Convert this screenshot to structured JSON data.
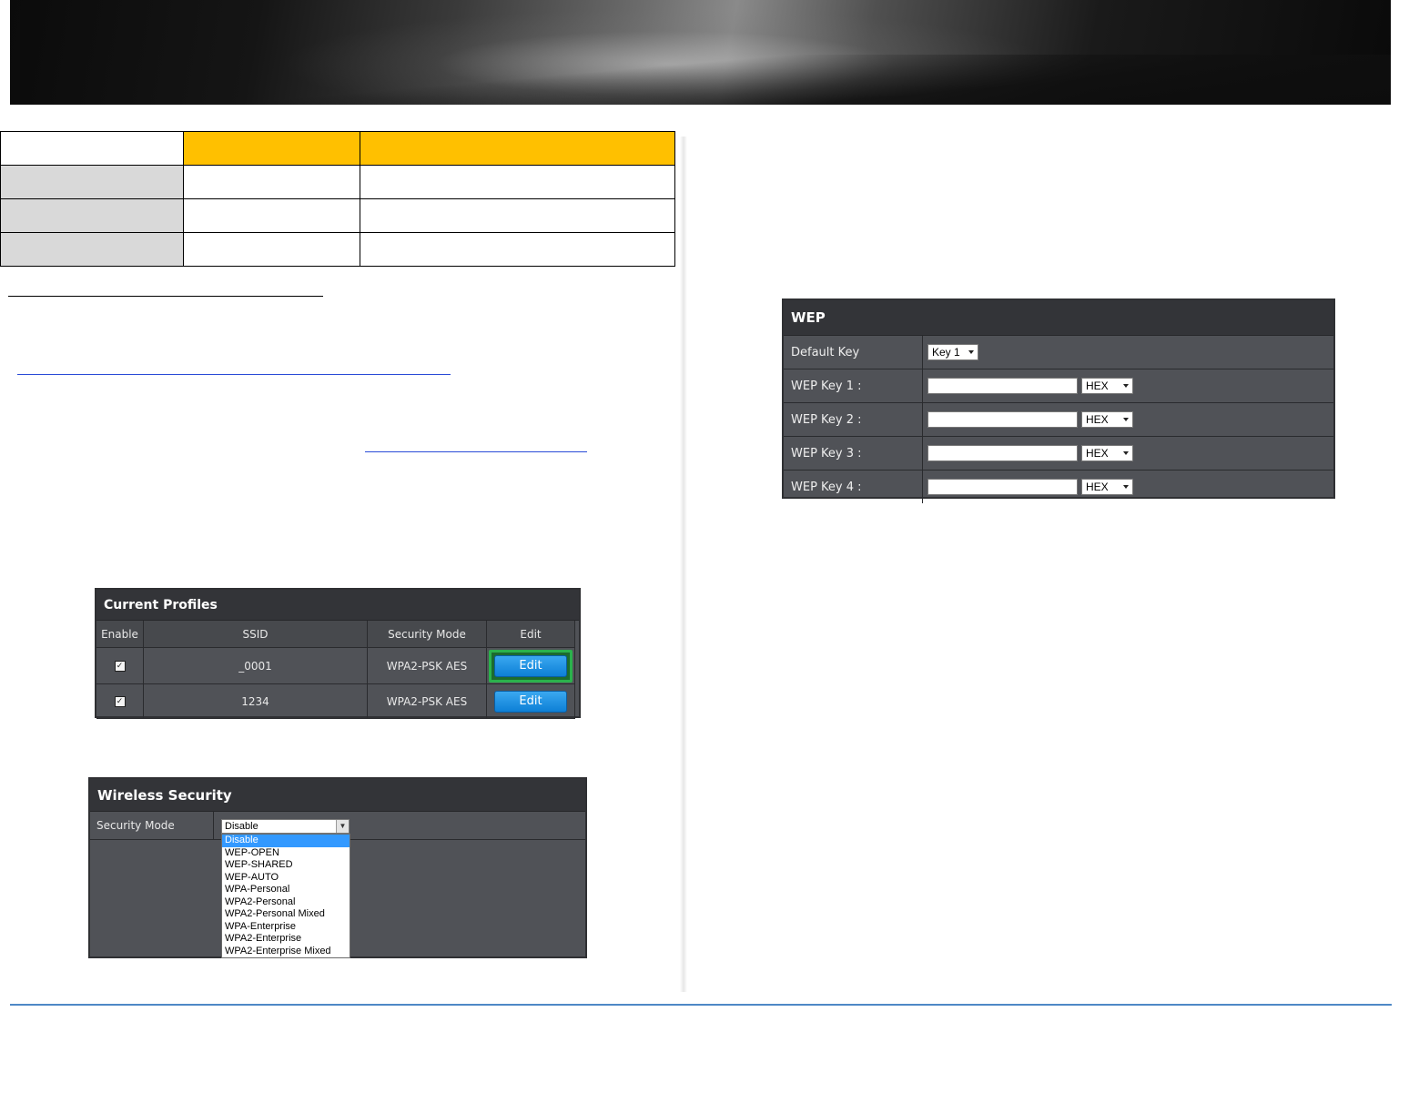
{
  "spec_table": {
    "rows": [
      {
        "c1": "",
        "c2": "",
        "c3": ""
      },
      {
        "c1": "",
        "c2": "",
        "c3": ""
      },
      {
        "c1": "",
        "c2": "",
        "c3": ""
      },
      {
        "c1": "",
        "c2": "",
        "c3": ""
      }
    ]
  },
  "profiles": {
    "title": "Current Profiles",
    "headers": [
      "Enable",
      "SSID",
      "Security Mode",
      "Edit"
    ],
    "rows": [
      {
        "enabled": "✓",
        "ssid": "_0001",
        "mode": "WPA2-PSK AES",
        "edit": "Edit"
      },
      {
        "enabled": "✓",
        "ssid": "1234",
        "mode": "WPA2-PSK AES",
        "edit": "Edit"
      }
    ]
  },
  "wireless_security": {
    "title": "Wireless Security",
    "label": "Security Mode",
    "selected": "Disable",
    "options": [
      "Disable",
      "WEP-OPEN",
      "WEP-SHARED",
      "WEP-AUTO",
      "WPA-Personal",
      "WPA2-Personal",
      "WPA2-Personal Mixed",
      "WPA-Enterprise",
      "WPA2-Enterprise",
      "WPA2-Enterprise Mixed"
    ]
  },
  "wep": {
    "title": "WEP",
    "default_key_label": "Default Key",
    "default_key_value": "Key 1",
    "keys": [
      {
        "label": "WEP Key 1 :",
        "format": "HEX"
      },
      {
        "label": "WEP Key 2 :",
        "format": "HEX"
      },
      {
        "label": "WEP Key 3 :",
        "format": "HEX"
      },
      {
        "label": "WEP Key 4 :",
        "format": "HEX"
      }
    ]
  },
  "colors": {
    "table_header": "#ffc000",
    "table_label": "#d9d9d9",
    "edit_highlight": "#2bb24c",
    "footer_rule": "#4f88c6",
    "link": "#2a4bd7"
  }
}
